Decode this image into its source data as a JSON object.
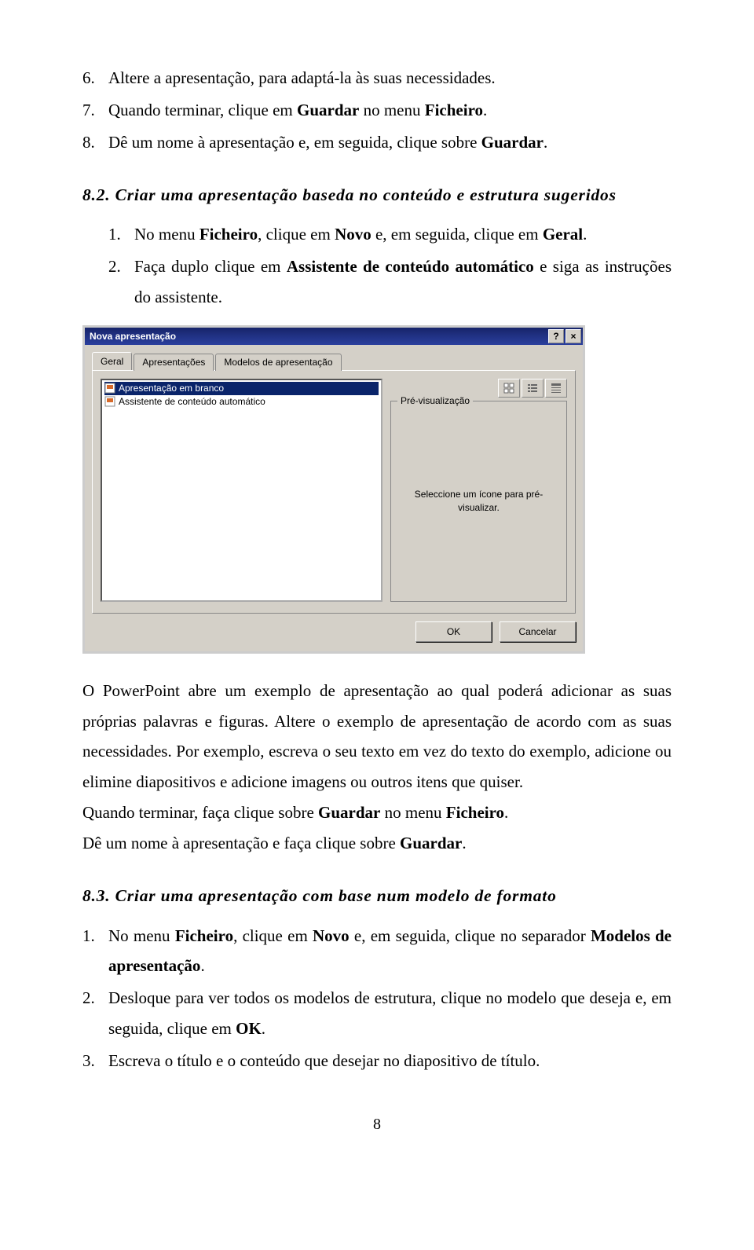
{
  "list6": {
    "num": "6.",
    "text": "Altere a apresentação, para adaptá-la às suas necessidades."
  },
  "list7": {
    "num": "7.",
    "pre": "Quando terminar, clique em ",
    "bold1": "Guardar",
    "mid": " no menu ",
    "bold2": "Ficheiro",
    "post": "."
  },
  "list8": {
    "num": "8.",
    "pre": "Dê um nome à apresentação e, em seguida, clique sobre ",
    "bold1": "Guardar",
    "post": "."
  },
  "heading82": "8.2. Criar uma apresentação baseda no conteúdo e estrutura sugeridos",
  "sub1": {
    "num": "1.",
    "pre": "No menu ",
    "bold1": "Ficheiro",
    "mid1": ", clique em ",
    "bold2": "Novo",
    "mid2": " e, em seguida, clique em ",
    "bold3": "Geral",
    "post": "."
  },
  "sub2": {
    "num": "2.",
    "pre": "Faça duplo clique em ",
    "bold1": "Assistente de conteúdo automático",
    "post": " e siga as instruções do assistente."
  },
  "dialog": {
    "title": "Nova apresentação",
    "help_symbol": "?",
    "close_symbol": "×",
    "tabs": {
      "geral": "Geral",
      "apresentacoes": "Apresentações",
      "modelos": "Modelos de apresentação"
    },
    "list_item1": "Apresentação em branco",
    "list_item2": "Assistente de conteúdo automático",
    "preview_legend": "Pré-visualização",
    "preview_hint": "Seleccione um ícone para pré-visualizar.",
    "ok": "OK",
    "cancel": "Cancelar"
  },
  "para1": {
    "t1": "O PowerPoint abre um exemplo de apresentação ao qual poderá adicionar as suas próprias palavras e figuras. Altere o exemplo de apresentação de acordo com as suas necessidades. Por exemplo, escreva o seu texto em vez do texto do exemplo, adicione ou elimine diapositivos e adicione imagens ou outros itens que quiser."
  },
  "para2": {
    "pre": "Quando terminar, faça clique sobre ",
    "bold1": "Guardar",
    "mid": " no menu ",
    "bold2": "Ficheiro",
    "post": "."
  },
  "para3": {
    "pre": "Dê um nome à apresentação e faça clique sobre ",
    "bold1": "Guardar",
    "post": "."
  },
  "heading83": "8.3. Criar uma apresentação com base num modelo de formato",
  "s83_1": {
    "num": "1.",
    "pre": "No menu ",
    "bold1": "Ficheiro",
    "mid1": ", clique em  ",
    "bold2": "Novo",
    "mid2": " e, em seguida, clique no separador ",
    "bold3": "Modelos de apresentação",
    "post": "."
  },
  "s83_2": {
    "num": "2.",
    "pre": "Desloque para ver todos os modelos de estrutura, clique no modelo que deseja e, em seguida, clique em ",
    "bold1": "OK",
    "post": "."
  },
  "s83_3": {
    "num": "3.",
    "text": "Escreva o título e o conteúdo que desejar no diapositivo de título."
  },
  "page_number": "8"
}
